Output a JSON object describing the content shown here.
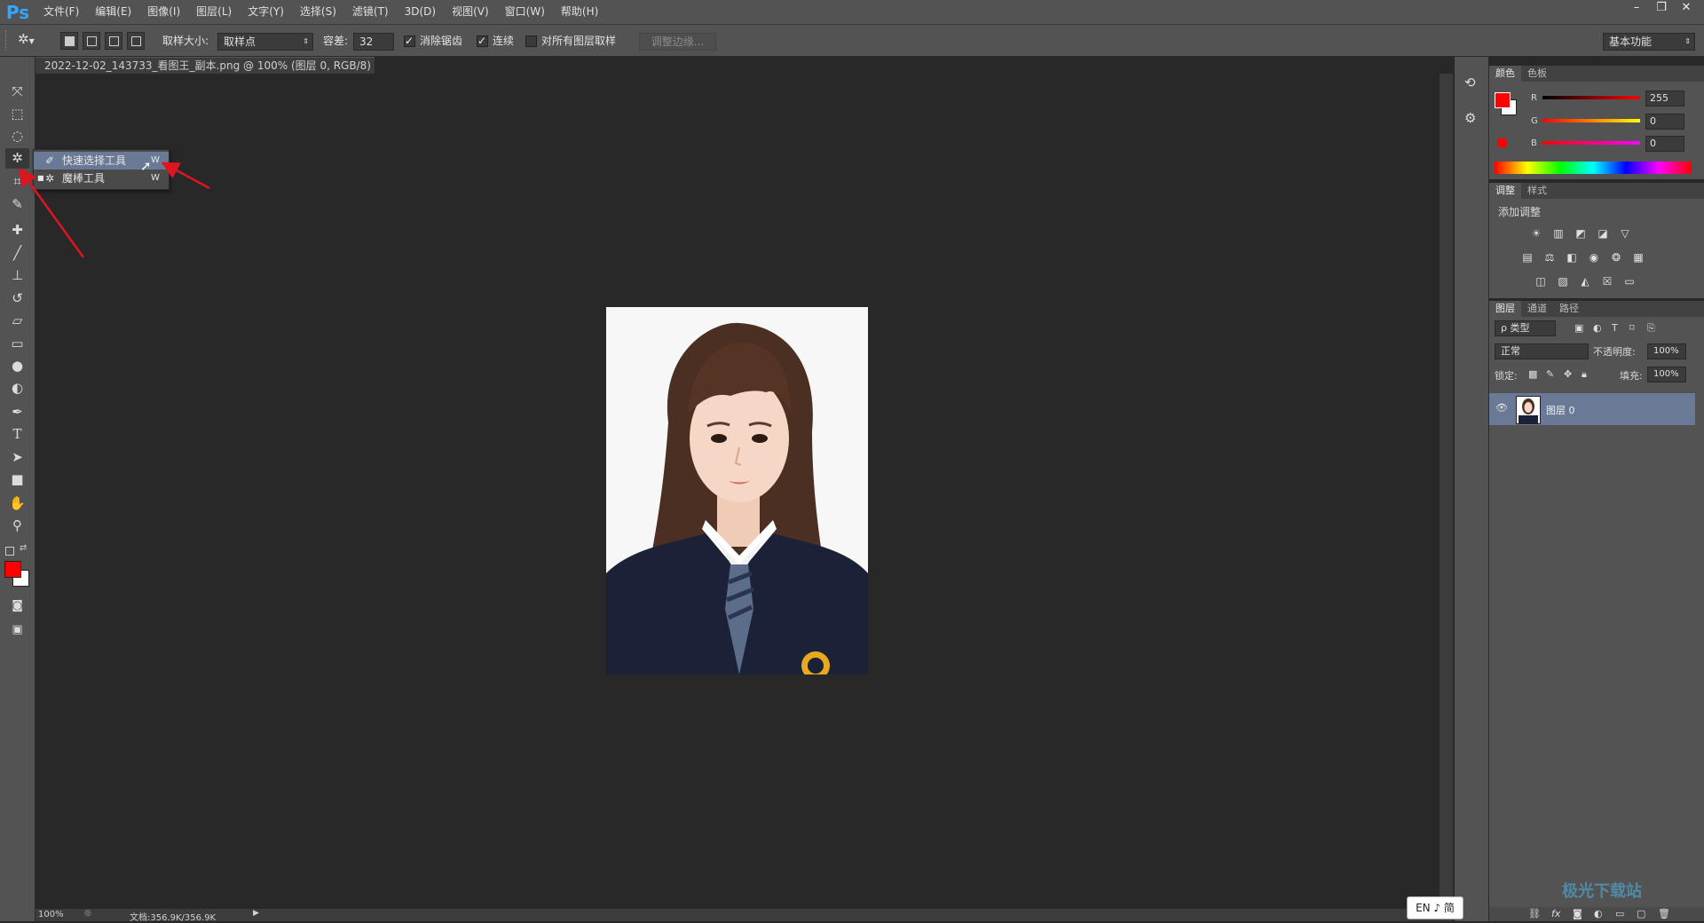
{
  "menubar": {
    "logo": "Ps",
    "items": [
      "文件(F)",
      "编辑(E)",
      "图像(I)",
      "图层(L)",
      "文字(Y)",
      "选择(S)",
      "滤镜(T)",
      "3D(D)",
      "视图(V)",
      "窗口(W)",
      "帮助(H)"
    ]
  },
  "options": {
    "sample_size_label": "取样大小:",
    "sample_size_value": "取样点",
    "tolerance_label": "容差:",
    "tolerance_value": "32",
    "antialias_label": "消除锯齿",
    "contiguous_label": "连续",
    "all_layers_label": "对所有图层取样",
    "refine_edge_label": "调整边缘...",
    "workspace_value": "基本功能"
  },
  "document": {
    "tab_title": "2022-12-02_143733_看图王_副本.png @ 100% (图层 0, RGB/8) *",
    "tab_close": "×"
  },
  "flyout": {
    "items": [
      {
        "label": "快速选择工具",
        "shortcut": "W"
      },
      {
        "label": "魔棒工具",
        "shortcut": "W"
      }
    ]
  },
  "status": {
    "zoom": "100%",
    "doc_info": "文档:356.9K/356.9K"
  },
  "color_panel": {
    "tabs": [
      "颜色",
      "色板"
    ],
    "r_label": "R",
    "r_value": "255",
    "g_label": "G",
    "g_value": "0",
    "b_label": "B",
    "b_value": "0",
    "foreground": "#ff0000",
    "background": "#ffffff"
  },
  "adjust_panel": {
    "tabs": [
      "调整",
      "样式"
    ],
    "title": "添加调整"
  },
  "layers_panel": {
    "tabs": [
      "图层",
      "通道",
      "路径"
    ],
    "filter_label": "ρ 类型",
    "blend_mode": "正常",
    "opacity_label": "不透明度:",
    "opacity_value": "100%",
    "lock_label": "锁定:",
    "fill_label": "填充:",
    "fill_value": "100%",
    "layer_name": "图层 0"
  },
  "ime": {
    "text": "EN ♪ 简"
  },
  "watermark": "极光下载站",
  "colors": {
    "accent_blue": "#31a8ff",
    "selected_row": "#6a7a96",
    "arrow_red": "#e0141e"
  }
}
